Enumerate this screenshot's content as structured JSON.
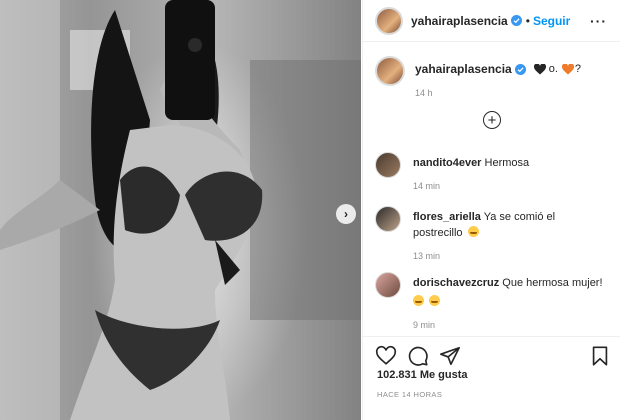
{
  "post": {
    "username": "yahairaplasencia",
    "follow_label": "Seguir",
    "dot": "•",
    "more_label": "···",
    "caption": {
      "text_middle": "o.",
      "text_end": "?",
      "time": "14 h",
      "heart_colors": [
        "#262626",
        "#f07b2a"
      ]
    },
    "load_more_label": "+",
    "comments": [
      {
        "user": "nandito4ever",
        "text": "Hermosa",
        "time": "14 min"
      },
      {
        "user": "flores_ariella",
        "text": "Ya se comió el postrecillo",
        "time": "13 min"
      },
      {
        "user": "dorischavezcruz",
        "text": "Que hermosa mujer!",
        "time": "9 min"
      }
    ],
    "likes": "102.831 Me gusta",
    "posted_ago": "HACE 14 HORAS",
    "icons": [
      "heart-icon",
      "comment-icon",
      "share-icon",
      "bookmark-icon",
      "verified-icon",
      "chevron-right-icon",
      "plus-circle-icon"
    ],
    "colors": {
      "accent": "#0095f6",
      "verified": "#3897f0",
      "muted": "#8e8e8e",
      "border": "#efefef"
    }
  }
}
